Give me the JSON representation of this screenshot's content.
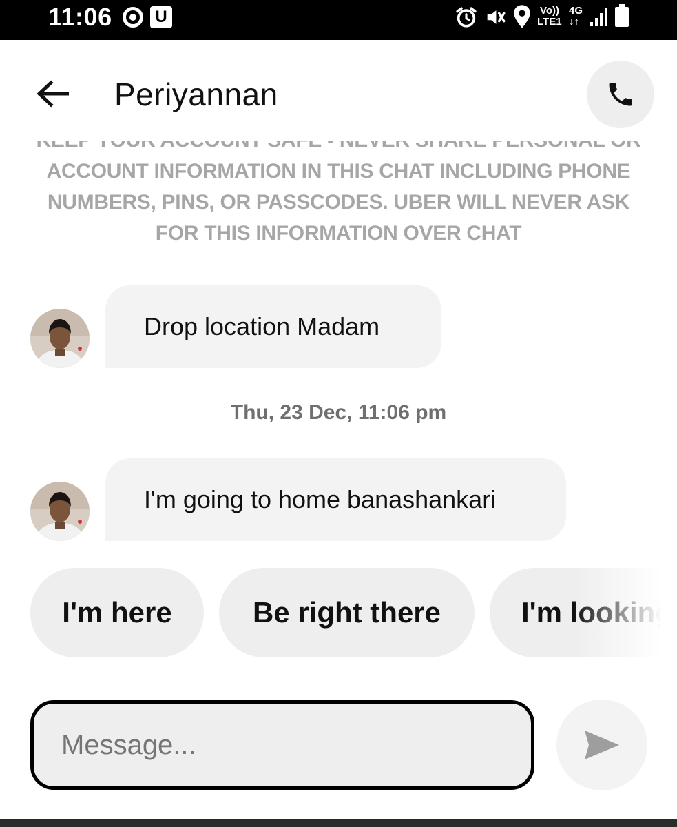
{
  "status_bar": {
    "time": "11:06",
    "u_badge": "U",
    "volte": "Vo))",
    "lte": "LTE1",
    "network": "4G",
    "network_arrows": "↓↑",
    "icons": [
      "record-icon",
      "u-app-icon",
      "alarm-icon",
      "vibrate-icon",
      "location-icon",
      "signal-icon",
      "battery-icon"
    ]
  },
  "header": {
    "contact_name": "Periyannan",
    "back_icon": "arrow-left-icon",
    "call_icon": "phone-icon"
  },
  "notice": {
    "text": "KEEP YOUR ACCOUNT SAFE - NEVER SHARE PERSONAL OR ACCOUNT INFORMATION IN THIS CHAT INCLUDING PHONE NUMBERS, PINS, OR PASSCODES. UBER WILL NEVER ASK FOR THIS INFORMATION OVER CHAT"
  },
  "messages": [
    {
      "text": "Drop location Madam"
    },
    {
      "text": "I'm going to home banashankari"
    }
  ],
  "date_stamp": "Thu, 23 Dec, 11:06 pm",
  "quick_replies": [
    "I'm here",
    "Be right there",
    "I'm looking"
  ],
  "composer": {
    "placeholder": "Message...",
    "value": "",
    "send_icon": "send-icon"
  },
  "colors": {
    "bubble": "#f3f3f3",
    "chip": "#eeeeee",
    "notice_text": "#a6a6a6",
    "status_bar": "#000000"
  }
}
